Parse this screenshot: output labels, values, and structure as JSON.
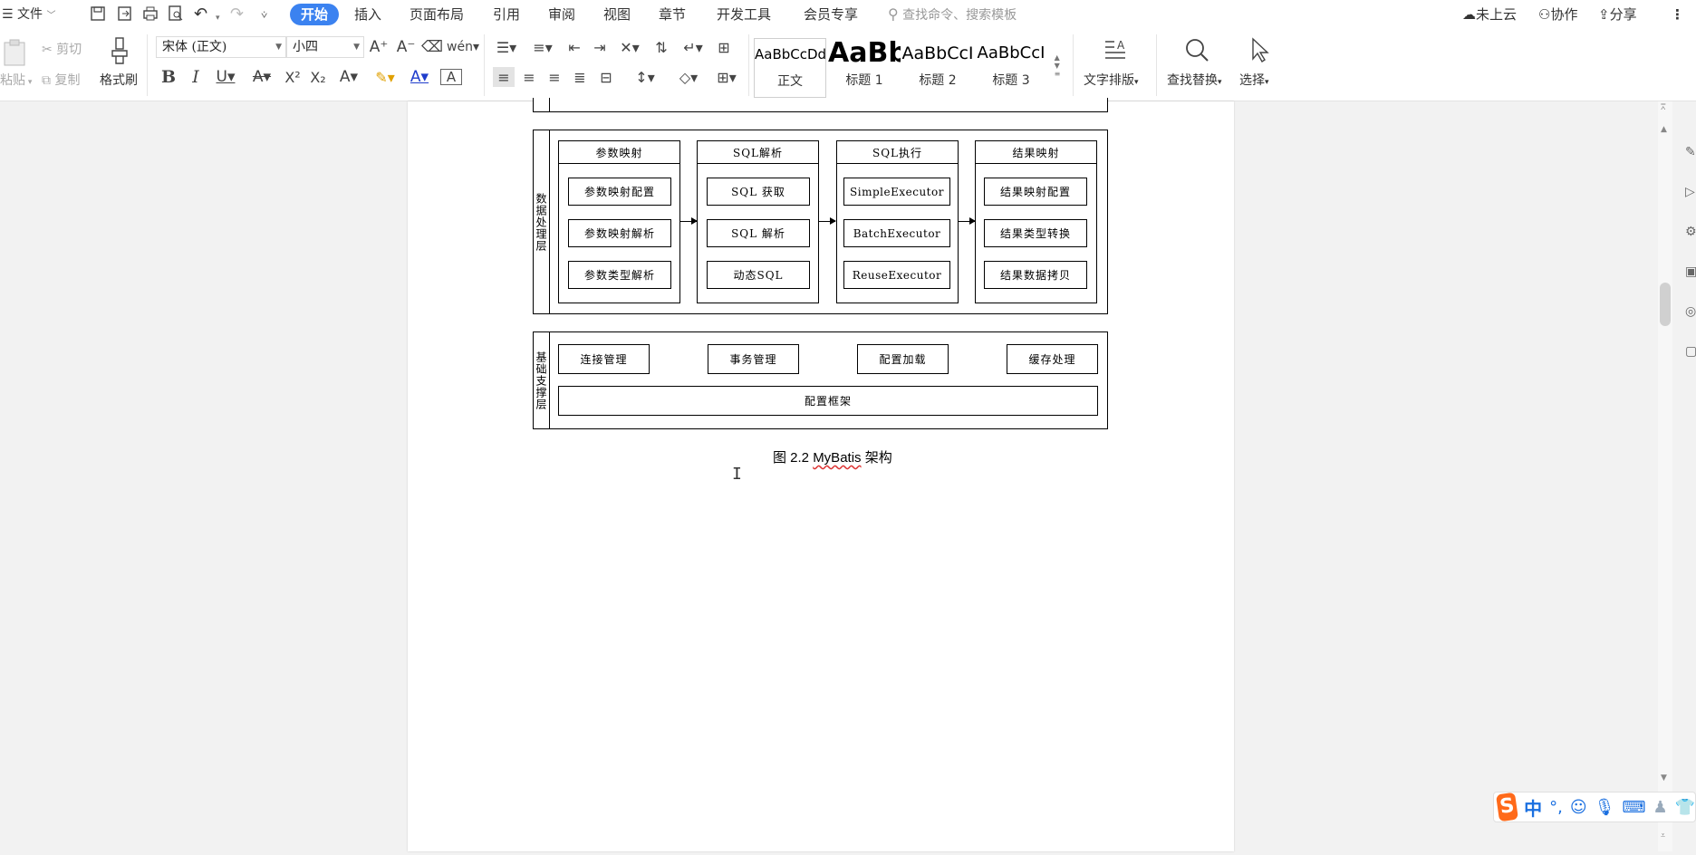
{
  "menubar": {
    "hamburger_label": "文件",
    "tabs": [
      "开始",
      "插入",
      "页面布局",
      "引用",
      "审阅",
      "视图",
      "章节",
      "开发工具",
      "会员专享"
    ],
    "search_placeholder": "查找命令、搜索模板",
    "not_synced": "未上云",
    "collaborate": "协作",
    "share": "分享"
  },
  "ribbon": {
    "paste": "粘贴",
    "cut": "剪切",
    "copy": "复制",
    "format_painter": "格式刷",
    "font_name": "宋体 (正文)",
    "font_size": "小四",
    "styles": [
      {
        "sample": "AaBbCcDd",
        "name": "正文"
      },
      {
        "sample": "AaBb",
        "name": "标题 1"
      },
      {
        "sample": "AaBbCcI",
        "name": "标题 2"
      },
      {
        "sample": "AaBbCcI",
        "name": "标题 3"
      }
    ],
    "text_layout": "文字排版",
    "find_replace": "查找替换",
    "select": "选择"
  },
  "diagram": {
    "data_layer_label": "数据处理层",
    "columns": [
      {
        "header": "参数映射",
        "items": [
          "参数映射配置",
          "参数映射解析",
          "参数类型解析"
        ]
      },
      {
        "header": "SQL解析",
        "items": [
          "SQL 获取",
          "SQL 解析",
          "动态SQL"
        ]
      },
      {
        "header": "SQL执行",
        "items": [
          "SimpleExecutor",
          "BatchExecutor",
          "ReuseExecutor"
        ]
      },
      {
        "header": "结果映射",
        "items": [
          "结果映射配置",
          "结果类型转换",
          "结果数据拷贝"
        ]
      }
    ],
    "support_layer_label": "基础支撑层",
    "support_items": [
      "连接管理",
      "事务管理",
      "配置加载",
      "缓存处理"
    ],
    "config_framework": "配置框架"
  },
  "caption": {
    "prefix": "图 2.2 ",
    "word": "MyBatis",
    "suffix": " 架构"
  },
  "ime": {
    "lang": "中",
    "punct": "°,"
  }
}
